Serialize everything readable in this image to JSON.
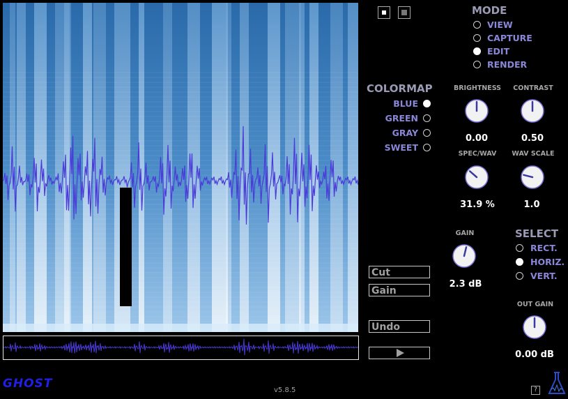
{
  "top_buttons": [
    {
      "name": "view-toggle-a"
    },
    {
      "name": "view-toggle-b"
    }
  ],
  "mode": {
    "title": "MODE",
    "options": [
      {
        "label": "VIEW",
        "selected": false
      },
      {
        "label": "CAPTURE",
        "selected": false
      },
      {
        "label": "EDIT",
        "selected": true
      },
      {
        "label": "RENDER",
        "selected": false
      }
    ]
  },
  "colormap": {
    "title": "COLORMAP",
    "options": [
      {
        "label": "BLUE",
        "selected": true
      },
      {
        "label": "GREEN",
        "selected": false
      },
      {
        "label": "GRAY",
        "selected": false
      },
      {
        "label": "SWEET",
        "selected": false
      }
    ]
  },
  "knobs": {
    "brightness": {
      "label": "BRIGHTNESS",
      "value": "0.00",
      "level": 0.5
    },
    "contrast": {
      "label": "CONTRAST",
      "value": "0.50",
      "level": 0.5
    },
    "spec_wav": {
      "label": "SPEC/WAV",
      "value": "31.9 %",
      "level": 0.32
    },
    "wav_scale": {
      "label": "WAV SCALE",
      "value": "1.0",
      "level": 0.22
    },
    "gain": {
      "label": "GAIN",
      "value": "2.3 dB",
      "level": 0.55
    },
    "out_gain": {
      "label": "OUT GAIN",
      "value": "0.00 dB",
      "level": 0.5
    }
  },
  "select": {
    "title": "SELECT",
    "options": [
      {
        "label": "RECT.",
        "selected": false
      },
      {
        "label": "HORIZ.",
        "selected": true
      },
      {
        "label": "VERT.",
        "selected": false
      }
    ]
  },
  "buttons": {
    "cut": "Cut",
    "gain": "Gain",
    "undo": "Undo",
    "play_icon": "play-icon"
  },
  "footer": {
    "logo": "GHOST",
    "version": "v5.8.5",
    "help": "?",
    "flask_icon": "flask-icon"
  },
  "colors": {
    "accent": "#8a86d8",
    "waveform": "#4a3ad8",
    "spectrogram": "#3a7fc0"
  }
}
